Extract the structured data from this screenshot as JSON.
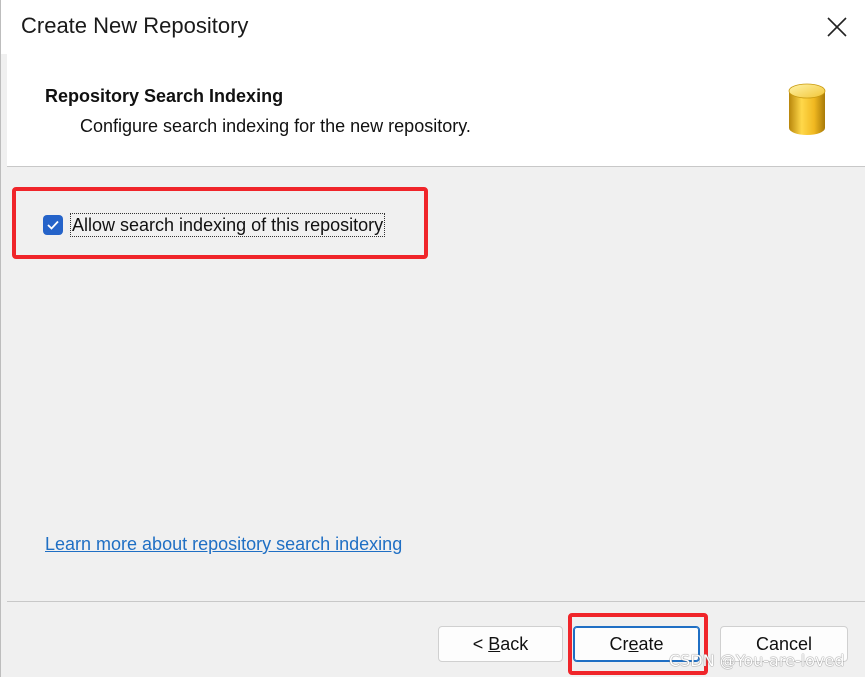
{
  "window": {
    "title": "Create New Repository"
  },
  "header": {
    "title": "Repository Search Indexing",
    "subtitle": "Configure search indexing for the new repository.",
    "icon": "database-icon"
  },
  "options": {
    "allow_indexing_label": "Allow search indexing of this repository",
    "allow_indexing_checked": true
  },
  "links": {
    "learn_more": "Learn more about repository search indexing"
  },
  "buttons": {
    "back_prefix": "< ",
    "back_mnemonic": "B",
    "back_rest": "ack",
    "create_prefix": "Cr",
    "create_mnemonic": "e",
    "create_rest": "ate",
    "cancel": "Cancel"
  },
  "watermark": "CSDN @You-are-loved",
  "colors": {
    "highlight": "#f0252a",
    "link": "#1f6fc4",
    "checkbox": "#2563c9",
    "background": "#f0f0f0"
  }
}
